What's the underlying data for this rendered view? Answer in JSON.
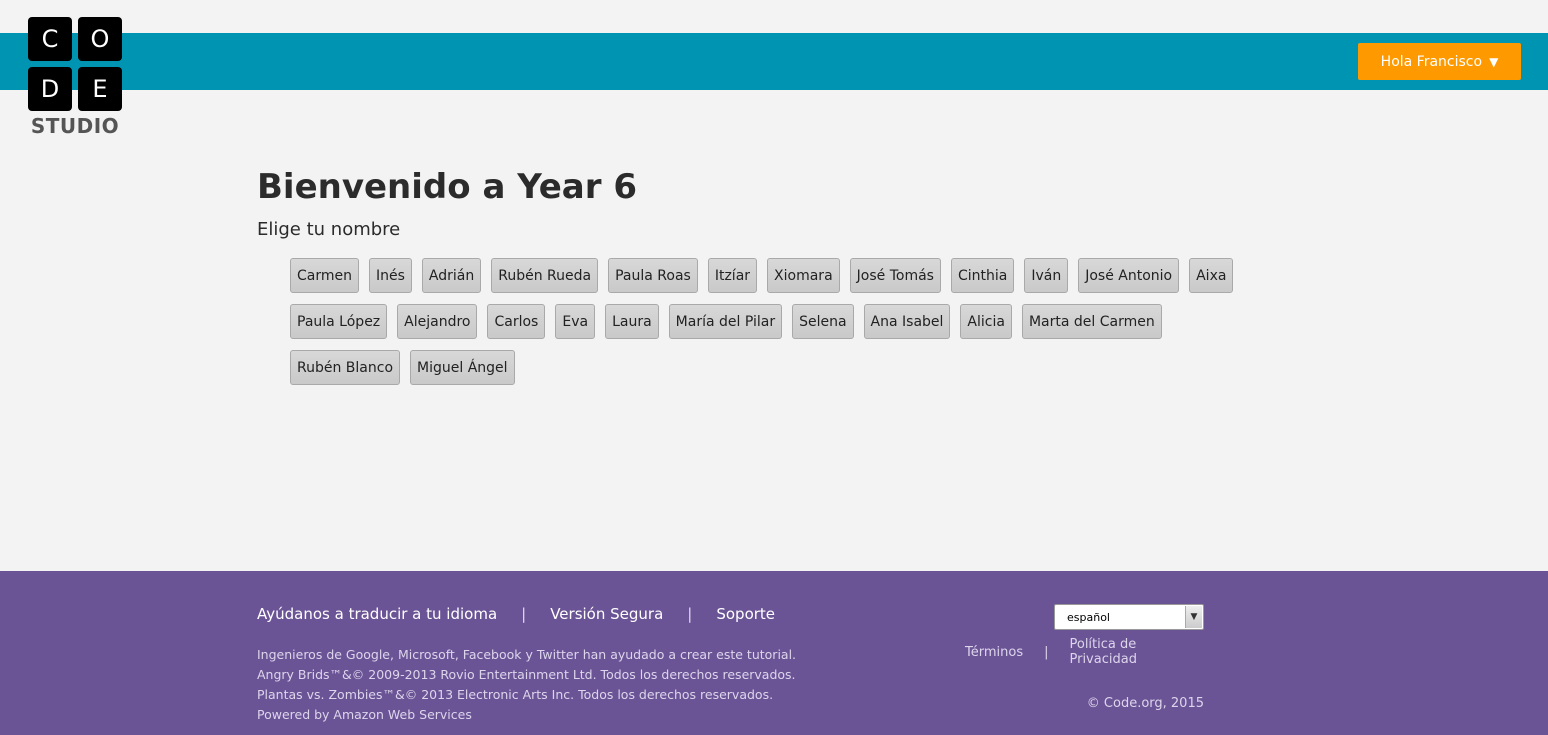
{
  "header": {
    "logo_letters": [
      "C",
      "O",
      "D",
      "E"
    ],
    "logo_sub": "STUDIO",
    "user_button_label": "Hola Francisco",
    "user_button_caret": "▼",
    "colors": {
      "band": "#0094b3",
      "user_button": "#ff9900"
    }
  },
  "main": {
    "title": "Bienvenido a Year 6",
    "subtitle": "Elige tu nombre",
    "names": [
      "Carmen",
      "Inés",
      "Adrián",
      "Rubén Rueda",
      "Paula Roas",
      "Itzíar",
      "Xiomara",
      "José Tomás",
      "Cinthia",
      "Iván",
      "José Antonio",
      "Aixa",
      "Paula López",
      "Alejandro",
      "Carlos",
      "Eva",
      "Laura",
      "María del Pilar",
      "Selena",
      "Ana Isabel",
      "Alicia",
      "Marta del Carmen",
      "Rubén Blanco",
      "Miguel Ángel"
    ]
  },
  "footer": {
    "links": [
      "Ayúdanos a traducir a tu idioma",
      "Versión Segura",
      "Soporte"
    ],
    "separator": "|",
    "credits": [
      "Ingenieros de Google, Microsoft, Facebook y Twitter han ayudado a crear este tutorial.",
      "Angry Brids™&© 2009-2013 Rovio Entertainment Ltd. Todos los derechos reservados.",
      "Plantas vs. Zombies™&© 2013 Electronic Arts Inc. Todos los derechos reservados.",
      "Powered by Amazon Web Services"
    ],
    "language_selected": "español",
    "legal_links": [
      "Términos",
      "Política de Privacidad"
    ],
    "copyright": "© Code.org, 2015",
    "colors": {
      "background": "#6b5496"
    }
  }
}
